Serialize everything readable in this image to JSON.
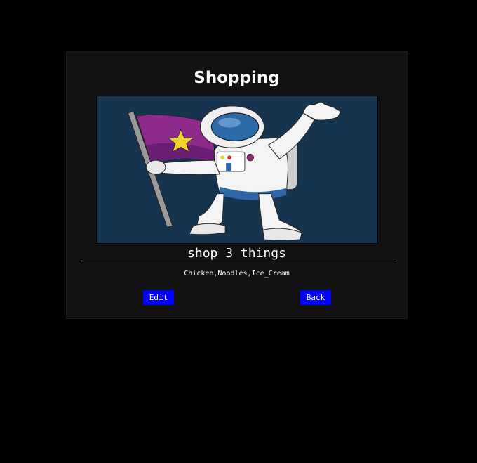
{
  "page": {
    "title": "Shopping",
    "subtitle": "shop 3 things",
    "items_text": "Chicken,Noodles,Ice_Cream"
  },
  "image": {
    "description_icon": "astronaut-with-flag-illustration"
  },
  "buttons": {
    "edit_label": "Edit",
    "back_label": "Back"
  },
  "colors": {
    "background": "#000000",
    "card": "#111111",
    "button": "#0000ff",
    "image_bg": "#17344e"
  }
}
